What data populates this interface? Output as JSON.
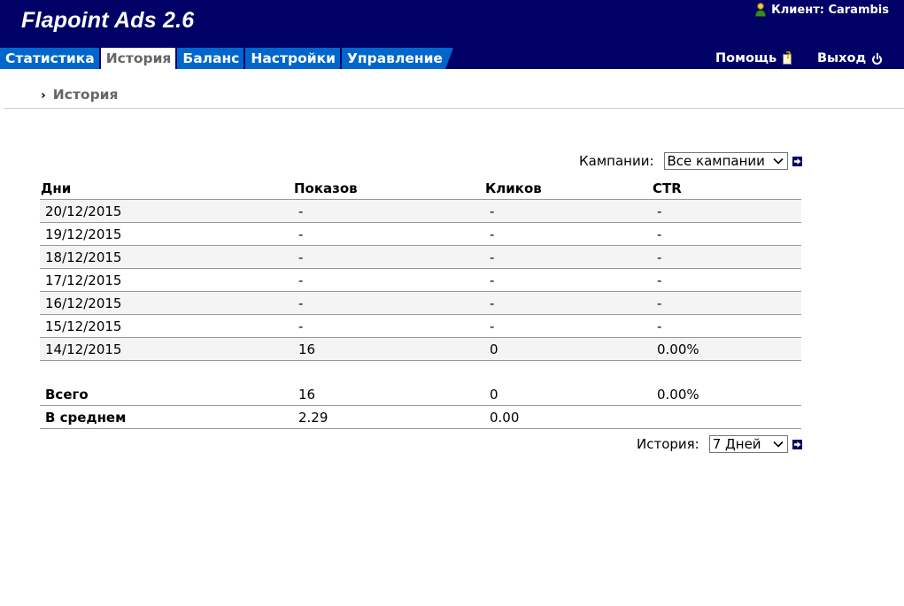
{
  "header": {
    "app_title": "Flapoint Ads 2.6",
    "client_label": "Клиент: Carambis"
  },
  "nav": {
    "tabs": [
      {
        "label": "Статистика",
        "active": false
      },
      {
        "label": "История",
        "active": true
      },
      {
        "label": "Баланс",
        "active": false
      },
      {
        "label": "Настройки",
        "active": false
      },
      {
        "label": "Управление",
        "active": false
      }
    ],
    "help_label": "Помощь",
    "logout_label": "Выход"
  },
  "breadcrumb": {
    "current": "История"
  },
  "campaign_filter": {
    "label": "Кампании:",
    "selected": "Все кампании"
  },
  "table": {
    "headers": [
      "Дни",
      "Показов",
      "Кликов",
      "CTR"
    ],
    "rows": [
      [
        "20/12/2015",
        "-",
        "-",
        "-"
      ],
      [
        "19/12/2015",
        "-",
        "-",
        "-"
      ],
      [
        "18/12/2015",
        "-",
        "-",
        "-"
      ],
      [
        "17/12/2015",
        "-",
        "-",
        "-"
      ],
      [
        "16/12/2015",
        "-",
        "-",
        "-"
      ],
      [
        "15/12/2015",
        "-",
        "-",
        "-"
      ],
      [
        "14/12/2015",
        "16",
        "0",
        "0.00%"
      ]
    ],
    "total": [
      "Всего",
      "16",
      "0",
      "0.00%"
    ],
    "average": [
      "В среднем",
      "2.29",
      "0.00",
      ""
    ]
  },
  "history_filter": {
    "label": "История:",
    "selected": "7 Дней"
  },
  "colors": {
    "header_bg": "#000066",
    "tab_bg": "#0066cc",
    "row_alt": "#f4f4f4"
  }
}
